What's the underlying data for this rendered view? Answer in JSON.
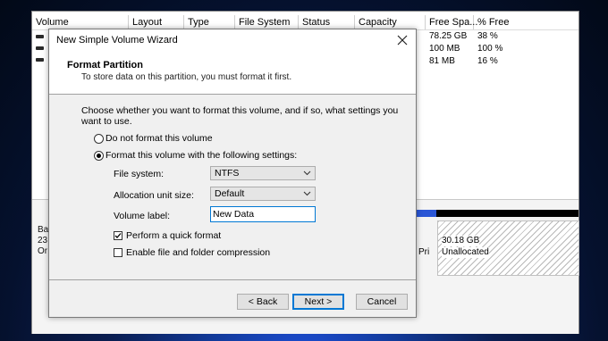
{
  "disk_management": {
    "columns": [
      "Volume",
      "Layout",
      "Type",
      "File System",
      "Status",
      "Capacity",
      "Free Spa...",
      "% Free"
    ],
    "rows": [
      {
        "free_space": "78.25 GB",
        "percent_free": "38 %"
      },
      {
        "free_space": "100 MB",
        "percent_free": "100 %"
      },
      {
        "free_space": "81 MB",
        "percent_free": "16 %"
      }
    ],
    "disk_label_partial": [
      "Ba",
      "23",
      "Or"
    ],
    "primary_partial": "Pri",
    "unallocated": {
      "size": "30.18 GB",
      "label": "Unallocated"
    }
  },
  "wizard": {
    "title": "New Simple Volume Wizard",
    "header": {
      "title": "Format Partition",
      "subtitle": "To store data on this partition, you must format it first."
    },
    "question": "Choose whether you want to format this volume, and if so, what settings you want to use.",
    "options": {
      "no_format": "Do not format this volume",
      "format": "Format this volume with the following settings:",
      "selected": "format"
    },
    "fields": {
      "file_system": {
        "label": "File system:",
        "value": "NTFS"
      },
      "allocation_unit": {
        "label": "Allocation unit size:",
        "value": "Default"
      },
      "volume_label": {
        "label": "Volume label:",
        "value": "New Data"
      }
    },
    "checkboxes": {
      "quick_format": {
        "label": "Perform a quick format",
        "checked": true
      },
      "compression": {
        "label": "Enable file and folder compression",
        "checked": false
      }
    },
    "buttons": {
      "back": "< Back",
      "next": "Next >",
      "cancel": "Cancel"
    }
  }
}
